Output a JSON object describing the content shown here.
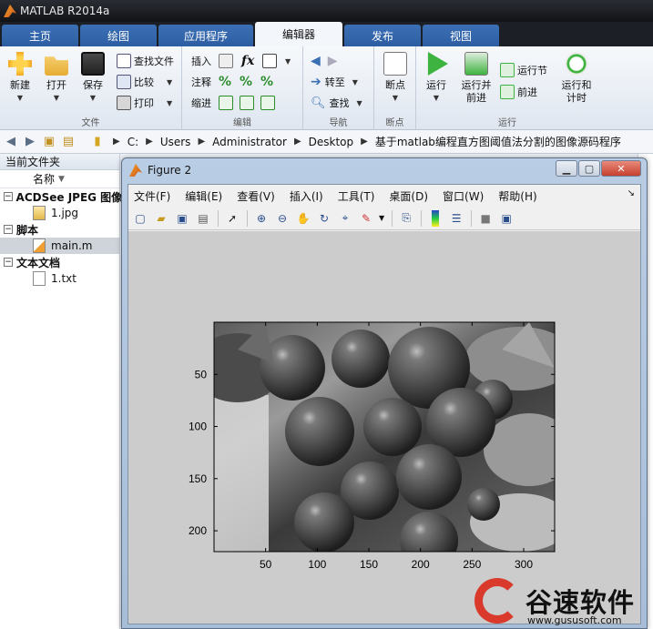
{
  "app": {
    "title": "MATLAB R2014a"
  },
  "tabs": [
    {
      "label": "主页"
    },
    {
      "label": "绘图"
    },
    {
      "label": "应用程序"
    },
    {
      "label": "编辑器",
      "active": true
    },
    {
      "label": "发布"
    },
    {
      "label": "视图"
    }
  ],
  "ribbon": {
    "file_group": {
      "label": "文件",
      "new": "新建",
      "open": "打开",
      "save": "保存",
      "find_files": "查找文件",
      "compare": "比较",
      "print": "打印"
    },
    "edit_group": {
      "label": "编辑",
      "insert": "插入",
      "comment": "注释",
      "indent": "缩进",
      "fx_label": "fx"
    },
    "nav_group": {
      "label": "导航",
      "go_to": "转至",
      "find": "查找"
    },
    "breakpoints_group": {
      "label": "断点",
      "breakpoints": "断点"
    },
    "run_group": {
      "label": "运行",
      "run": "运行",
      "run_and_advance": "运行并\n前进",
      "run_section": "运行节",
      "advance": "前进",
      "run_and_time": "运行和\n计时"
    }
  },
  "address": {
    "path": [
      "C:",
      "Users",
      "Administrator",
      "Desktop",
      "基于matlab编程直方图阈值法分割的图像源码程序"
    ]
  },
  "file_panel": {
    "title": "当前文件夹",
    "column_name": "名称",
    "groups": [
      {
        "label": "ACDSee JPEG 图像",
        "files": [
          {
            "name": "1.jpg",
            "icon": "jpg-file-icon"
          }
        ]
      },
      {
        "label": "脚本",
        "files": [
          {
            "name": "main.m",
            "icon": "matlab-script-icon",
            "selected": true
          }
        ]
      },
      {
        "label": "文本文档",
        "files": [
          {
            "name": "1.txt",
            "icon": "text-file-icon"
          }
        ]
      }
    ]
  },
  "figure": {
    "title": "Figure 2",
    "menus": [
      "文件(F)",
      "编辑(E)",
      "查看(V)",
      "插入(I)",
      "工具(T)",
      "桌面(D)",
      "窗口(W)",
      "帮助(H)"
    ],
    "toolbar_icons": [
      "new-figure-icon",
      "open-file-icon",
      "save-icon",
      "print-icon",
      "pointer-icon",
      "zoom-in-icon",
      "zoom-out-icon",
      "pan-icon",
      "rotate-3d-icon",
      "data-cursor-icon",
      "brush-icon",
      "link-plot-icon",
      "colorbar-icon",
      "legend-icon",
      "hide-plot-tools-icon",
      "show-plot-tools-icon"
    ],
    "axes": {
      "x_ticks": [
        "50",
        "100",
        "150",
        "200",
        "250",
        "300"
      ],
      "y_ticks": [
        "50",
        "100",
        "150",
        "200"
      ],
      "image_desc": "grayscale image of cherries"
    }
  },
  "watermark": {
    "text": "谷速软件",
    "url": "www.gususoft.com"
  },
  "colors": {
    "accent_tab": "#2d5ea3",
    "ribbon_bg": "#e8eef6",
    "watermark_red": "#d93a2b"
  }
}
